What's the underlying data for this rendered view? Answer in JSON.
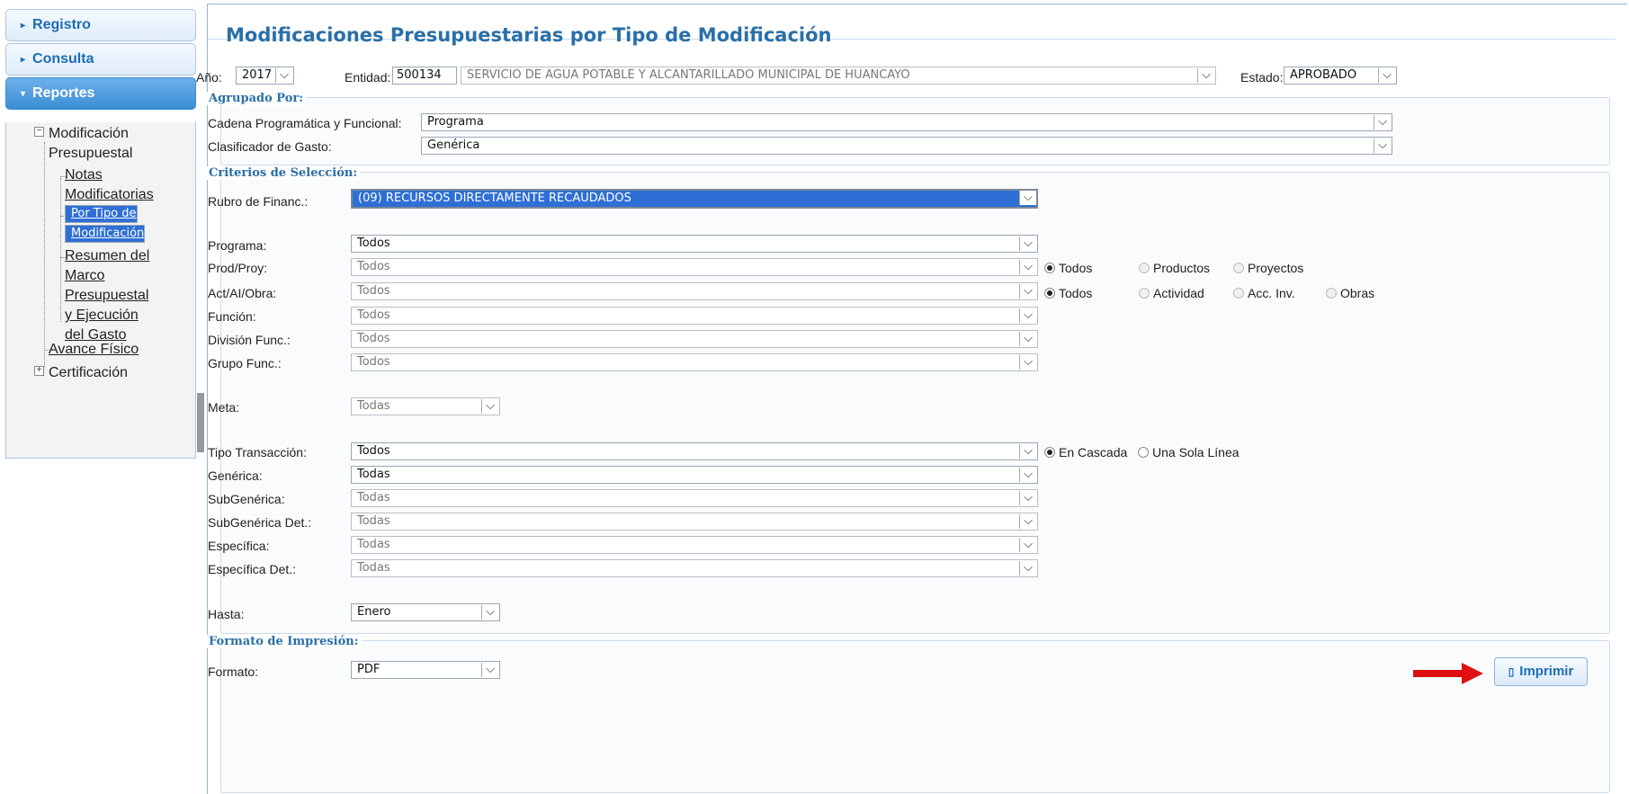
{
  "sidebar": {
    "items": [
      {
        "label": "Registro"
      },
      {
        "label": "Consulta"
      },
      {
        "label": "Reportes"
      }
    ],
    "tree": {
      "modificacion": "Modificación Presupuestal",
      "modificacion_l1": "Modificación",
      "modificacion_l2": "Presupuestal",
      "notas_l1": "Notas",
      "notas_l2": "Modificatorias",
      "portipo_l1": "Por Tipo de",
      "portipo_l2": "Modificación",
      "resumen_l1": "Resumen del",
      "resumen_l2": "Marco",
      "resumen_l3": "Presupuestal",
      "resumen_l4": "y Ejecución",
      "resumen_l5": "del Gasto",
      "avance": "Avance Físico",
      "certificacion": "Certificación"
    }
  },
  "page": {
    "title": "Modificaciones Presupuestarias por Tipo de Modificación"
  },
  "header": {
    "anio_label": "Año:",
    "anio_value": "2017",
    "entidad_label": "Entidad:",
    "entidad_code": "500134",
    "entidad_name": "SERVICIO DE AGUA POTABLE Y ALCANTARILLADO MUNICIPAL DE HUANCAYO",
    "estado_label": "Estado:",
    "estado_value": "APROBADO"
  },
  "agrupado": {
    "legend": "Agrupado Por:",
    "cadena_label": "Cadena Programática y Funcional:",
    "cadena_value": "Programa",
    "clasificador_label": "Clasificador de Gasto:",
    "clasificador_value": "Genérica"
  },
  "criterios": {
    "legend": "Criterios de Selección:",
    "rubro_label": "Rubro de Financ.:",
    "rubro_value": "(09) RECURSOS DIRECTAMENTE RECAUDADOS",
    "programa_label": "Programa:",
    "programa_value": "Todos",
    "prodproy_label": "Prod/Proy:",
    "prodproy_value": "Todos",
    "prodproy_radios": [
      "Todos",
      "Productos",
      "Proyectos"
    ],
    "actai_label": "Act/AI/Obra:",
    "actai_value": "Todos",
    "actai_radios": [
      "Todos",
      "Actividad",
      "Acc. Inv.",
      "Obras"
    ],
    "funcion_label": "Función:",
    "funcion_value": "Todos",
    "division_label": "División Func.:",
    "division_value": "Todos",
    "grupo_label": "Grupo Func.:",
    "grupo_value": "Todos",
    "meta_label": "Meta:",
    "meta_value": "Todas",
    "tipo_label": "Tipo Transacción:",
    "tipo_value": "Todos",
    "tipo_radios": [
      "En Cascada",
      "Una Sola Línea"
    ],
    "generica_label": "Genérica:",
    "generica_value": "Todas",
    "subgenerica_label": "SubGenérica:",
    "subgenerica_value": "Todas",
    "subgenericadet_label": "SubGenérica Det.:",
    "subgenericadet_value": "Todas",
    "especifica_label": "Específica:",
    "especifica_value": "Todas",
    "especificadet_label": "Específica Det.:",
    "especificadet_value": "Todas",
    "hasta_label": "Hasta:",
    "hasta_value": "Enero"
  },
  "formato": {
    "legend": "Formato de Impresión:",
    "formato_label": "Formato:",
    "formato_value": "PDF",
    "print_label": "Imprimir"
  },
  "colors": {
    "accent": "#2a6fa8",
    "active_menu": "#3a8dd6",
    "selection": "#2e6fd5",
    "arrow": "#e01010"
  }
}
